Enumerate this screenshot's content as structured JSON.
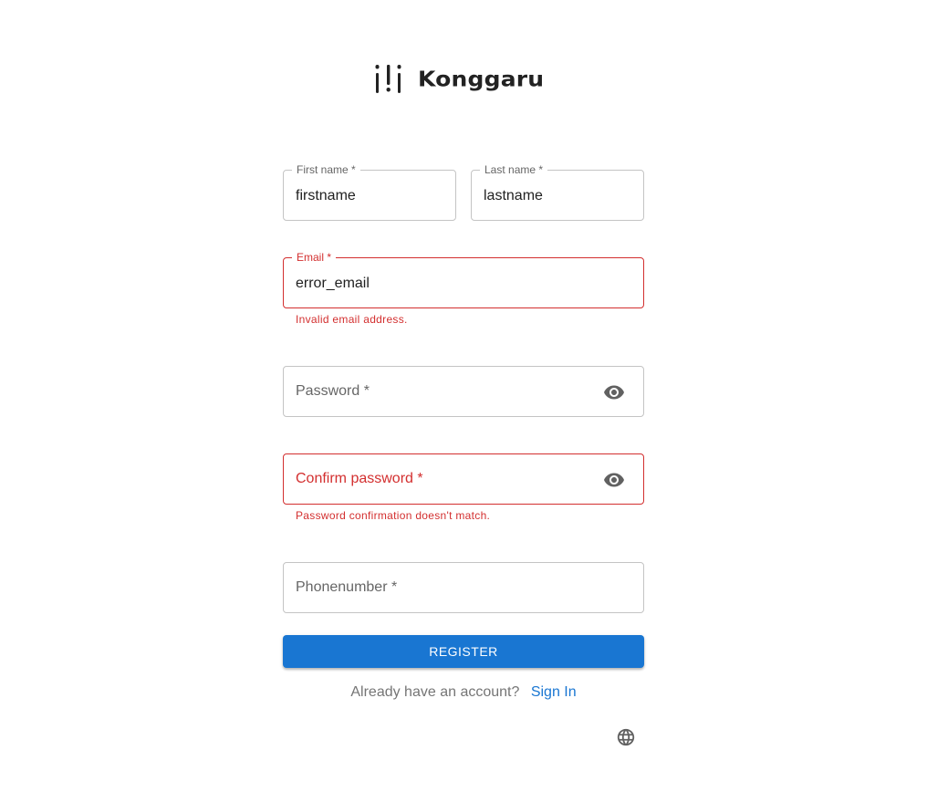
{
  "brand": {
    "name": "Konggaru"
  },
  "form": {
    "first_name": {
      "label": "First name *",
      "value": "firstname"
    },
    "last_name": {
      "label": "Last name *",
      "value": "lastname"
    },
    "email": {
      "label": "Email *",
      "value": "error_email",
      "error": "Invalid email address."
    },
    "password": {
      "label": "Password *",
      "icon": "visibility-icon"
    },
    "confirm_password": {
      "label": "Confirm password *",
      "icon": "visibility-icon",
      "error": "Password confirmation doesn't match."
    },
    "phone": {
      "label": "Phonenumber *"
    }
  },
  "actions": {
    "register_label": "REGISTER",
    "have_account_text": "Already have an account?",
    "sign_in_label": "Sign In",
    "language_icon": "globe-icon"
  },
  "colors": {
    "primary": "#1976d2",
    "error": "#d32f2f",
    "border": "#c4c4c4"
  }
}
